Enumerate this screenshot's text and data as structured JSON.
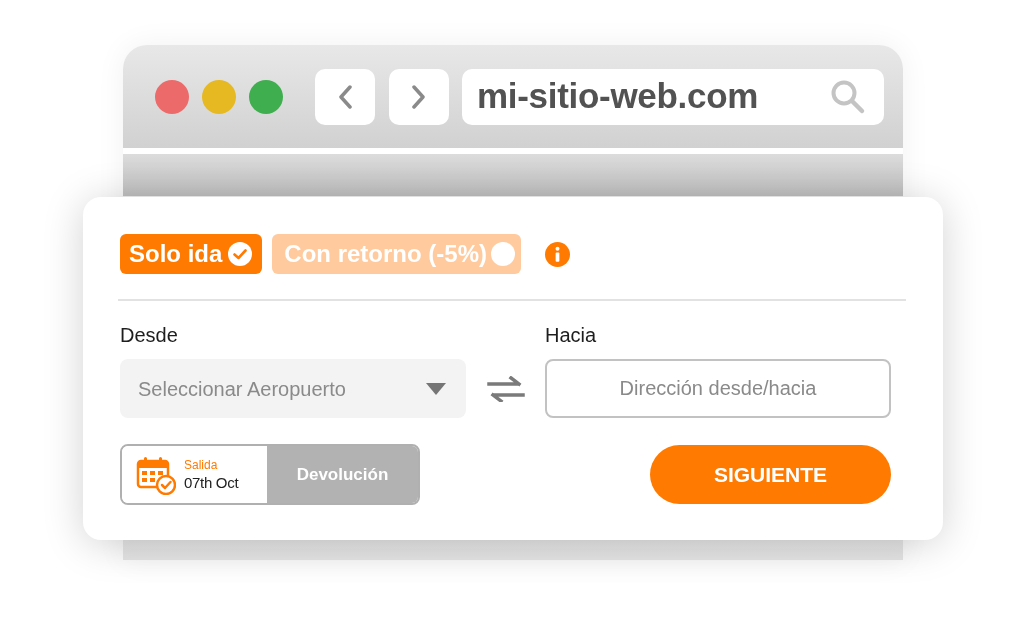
{
  "browser": {
    "url": "mi-sitio-web.com"
  },
  "trip_options": [
    {
      "label": "Solo ida",
      "selected": true
    },
    {
      "label": "Con retorno (-5%)",
      "selected": false
    }
  ],
  "from": {
    "label": "Desde",
    "placeholder": "Seleccionar Aeropuerto"
  },
  "to": {
    "label": "Hacia",
    "placeholder": "Dirección desde/hacia"
  },
  "dates": [
    {
      "label": "Salida",
      "value": "07th Oct",
      "selected": true
    },
    {
      "label": "Devolución",
      "selected": false
    }
  ],
  "next_button": "SIGUIENTE"
}
